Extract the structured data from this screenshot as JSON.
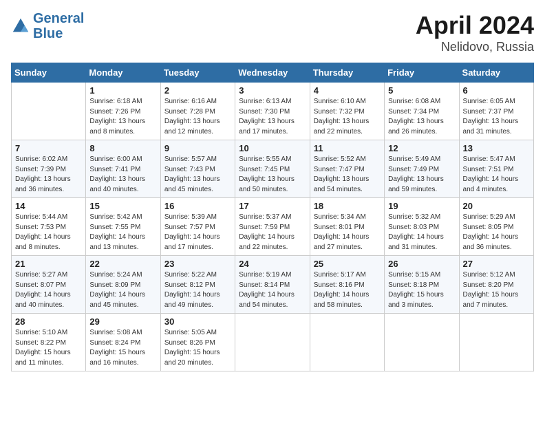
{
  "header": {
    "logo_line1": "General",
    "logo_line2": "Blue",
    "month": "April 2024",
    "location": "Nelidovo, Russia"
  },
  "weekdays": [
    "Sunday",
    "Monday",
    "Tuesday",
    "Wednesday",
    "Thursday",
    "Friday",
    "Saturday"
  ],
  "weeks": [
    [
      {
        "day": "",
        "info": ""
      },
      {
        "day": "1",
        "info": "Sunrise: 6:18 AM\nSunset: 7:26 PM\nDaylight: 13 hours\nand 8 minutes."
      },
      {
        "day": "2",
        "info": "Sunrise: 6:16 AM\nSunset: 7:28 PM\nDaylight: 13 hours\nand 12 minutes."
      },
      {
        "day": "3",
        "info": "Sunrise: 6:13 AM\nSunset: 7:30 PM\nDaylight: 13 hours\nand 17 minutes."
      },
      {
        "day": "4",
        "info": "Sunrise: 6:10 AM\nSunset: 7:32 PM\nDaylight: 13 hours\nand 22 minutes."
      },
      {
        "day": "5",
        "info": "Sunrise: 6:08 AM\nSunset: 7:34 PM\nDaylight: 13 hours\nand 26 minutes."
      },
      {
        "day": "6",
        "info": "Sunrise: 6:05 AM\nSunset: 7:37 PM\nDaylight: 13 hours\nand 31 minutes."
      }
    ],
    [
      {
        "day": "7",
        "info": "Sunrise: 6:02 AM\nSunset: 7:39 PM\nDaylight: 13 hours\nand 36 minutes."
      },
      {
        "day": "8",
        "info": "Sunrise: 6:00 AM\nSunset: 7:41 PM\nDaylight: 13 hours\nand 40 minutes."
      },
      {
        "day": "9",
        "info": "Sunrise: 5:57 AM\nSunset: 7:43 PM\nDaylight: 13 hours\nand 45 minutes."
      },
      {
        "day": "10",
        "info": "Sunrise: 5:55 AM\nSunset: 7:45 PM\nDaylight: 13 hours\nand 50 minutes."
      },
      {
        "day": "11",
        "info": "Sunrise: 5:52 AM\nSunset: 7:47 PM\nDaylight: 13 hours\nand 54 minutes."
      },
      {
        "day": "12",
        "info": "Sunrise: 5:49 AM\nSunset: 7:49 PM\nDaylight: 13 hours\nand 59 minutes."
      },
      {
        "day": "13",
        "info": "Sunrise: 5:47 AM\nSunset: 7:51 PM\nDaylight: 14 hours\nand 4 minutes."
      }
    ],
    [
      {
        "day": "14",
        "info": "Sunrise: 5:44 AM\nSunset: 7:53 PM\nDaylight: 14 hours\nand 8 minutes."
      },
      {
        "day": "15",
        "info": "Sunrise: 5:42 AM\nSunset: 7:55 PM\nDaylight: 14 hours\nand 13 minutes."
      },
      {
        "day": "16",
        "info": "Sunrise: 5:39 AM\nSunset: 7:57 PM\nDaylight: 14 hours\nand 17 minutes."
      },
      {
        "day": "17",
        "info": "Sunrise: 5:37 AM\nSunset: 7:59 PM\nDaylight: 14 hours\nand 22 minutes."
      },
      {
        "day": "18",
        "info": "Sunrise: 5:34 AM\nSunset: 8:01 PM\nDaylight: 14 hours\nand 27 minutes."
      },
      {
        "day": "19",
        "info": "Sunrise: 5:32 AM\nSunset: 8:03 PM\nDaylight: 14 hours\nand 31 minutes."
      },
      {
        "day": "20",
        "info": "Sunrise: 5:29 AM\nSunset: 8:05 PM\nDaylight: 14 hours\nand 36 minutes."
      }
    ],
    [
      {
        "day": "21",
        "info": "Sunrise: 5:27 AM\nSunset: 8:07 PM\nDaylight: 14 hours\nand 40 minutes."
      },
      {
        "day": "22",
        "info": "Sunrise: 5:24 AM\nSunset: 8:09 PM\nDaylight: 14 hours\nand 45 minutes."
      },
      {
        "day": "23",
        "info": "Sunrise: 5:22 AM\nSunset: 8:12 PM\nDaylight: 14 hours\nand 49 minutes."
      },
      {
        "day": "24",
        "info": "Sunrise: 5:19 AM\nSunset: 8:14 PM\nDaylight: 14 hours\nand 54 minutes."
      },
      {
        "day": "25",
        "info": "Sunrise: 5:17 AM\nSunset: 8:16 PM\nDaylight: 14 hours\nand 58 minutes."
      },
      {
        "day": "26",
        "info": "Sunrise: 5:15 AM\nSunset: 8:18 PM\nDaylight: 15 hours\nand 3 minutes."
      },
      {
        "day": "27",
        "info": "Sunrise: 5:12 AM\nSunset: 8:20 PM\nDaylight: 15 hours\nand 7 minutes."
      }
    ],
    [
      {
        "day": "28",
        "info": "Sunrise: 5:10 AM\nSunset: 8:22 PM\nDaylight: 15 hours\nand 11 minutes."
      },
      {
        "day": "29",
        "info": "Sunrise: 5:08 AM\nSunset: 8:24 PM\nDaylight: 15 hours\nand 16 minutes."
      },
      {
        "day": "30",
        "info": "Sunrise: 5:05 AM\nSunset: 8:26 PM\nDaylight: 15 hours\nand 20 minutes."
      },
      {
        "day": "",
        "info": ""
      },
      {
        "day": "",
        "info": ""
      },
      {
        "day": "",
        "info": ""
      },
      {
        "day": "",
        "info": ""
      }
    ]
  ]
}
